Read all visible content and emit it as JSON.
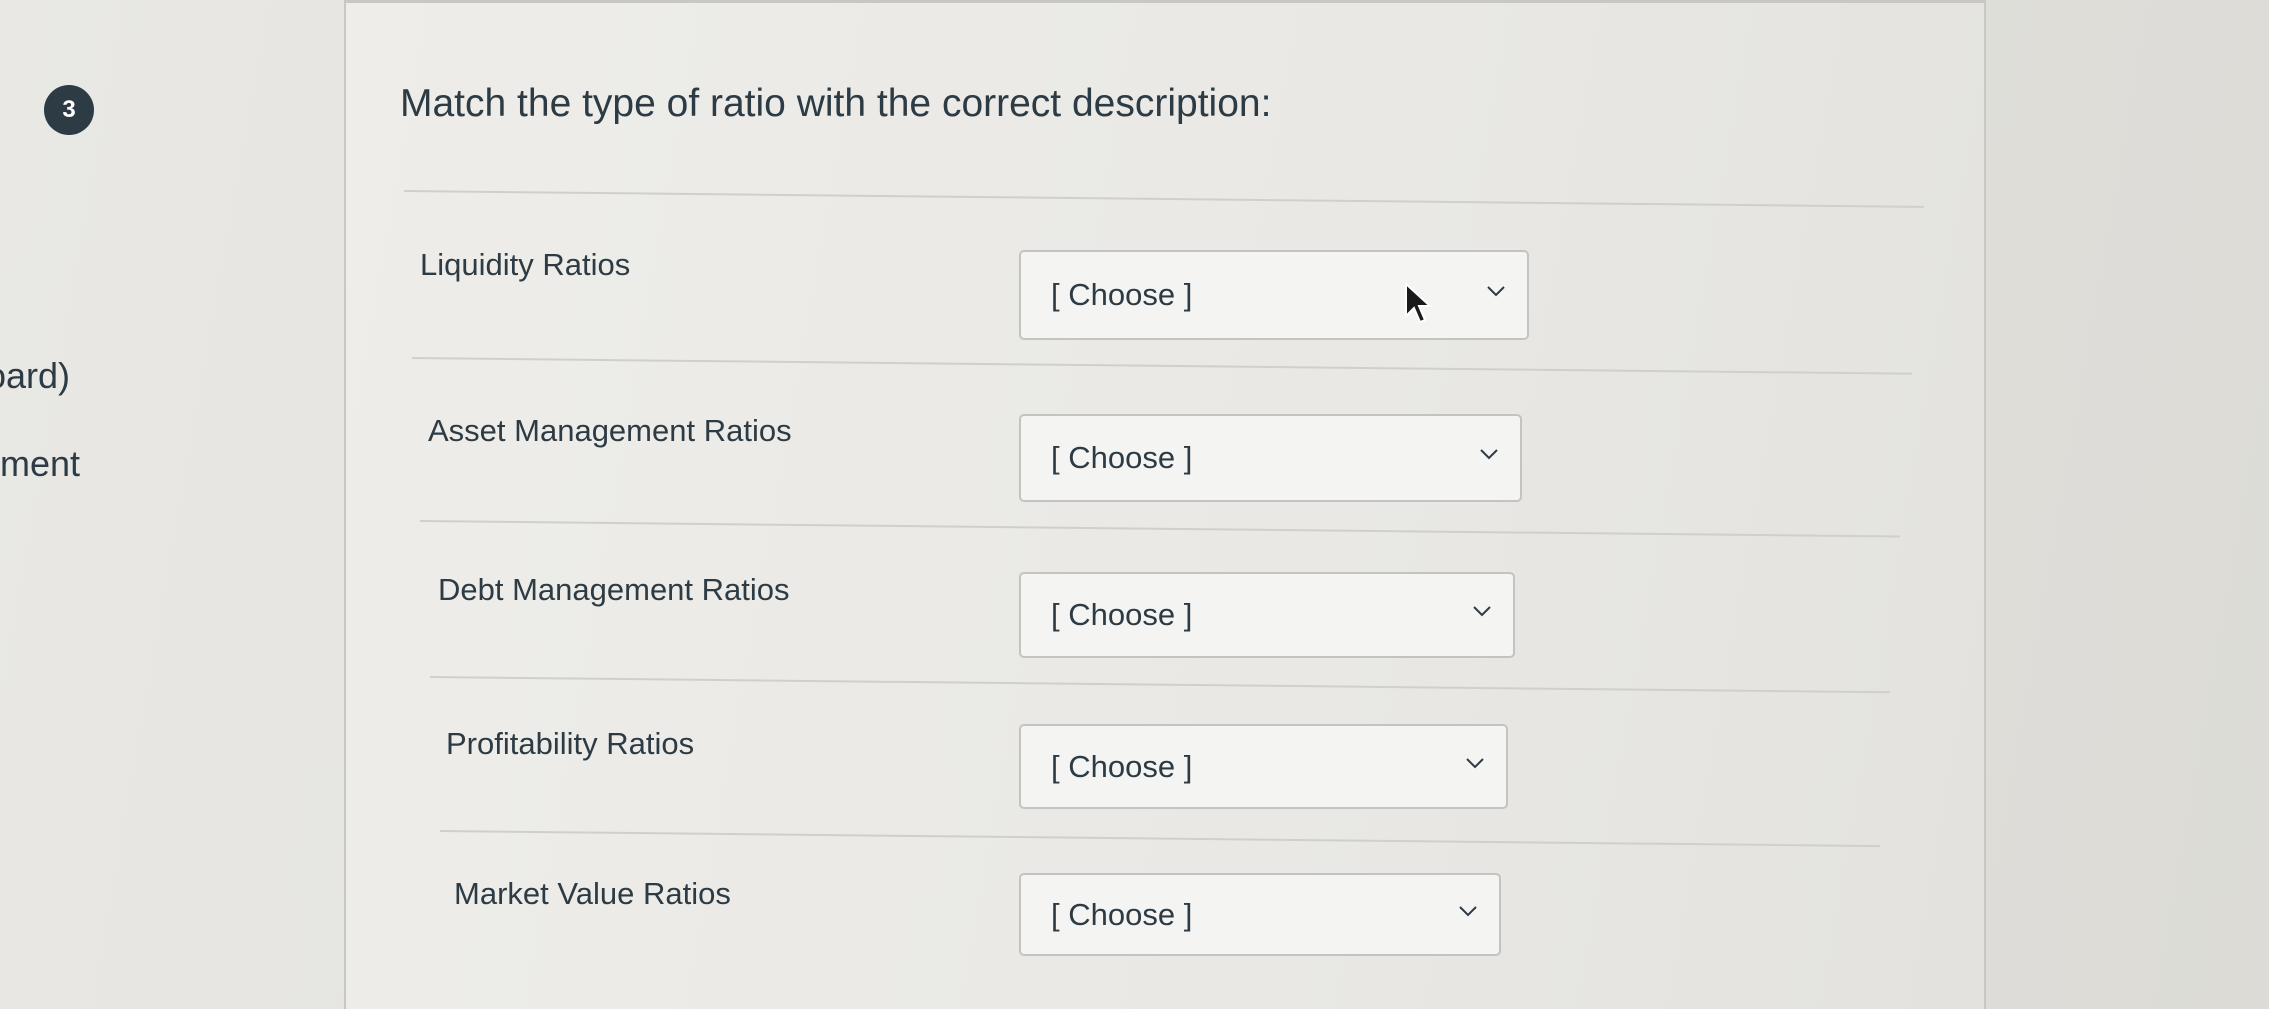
{
  "sidebar": {
    "partial_text_1": "oard)",
    "partial_text_2": "ment"
  },
  "question": {
    "number": "3",
    "prompt": "Match the type of ratio with the correct description:"
  },
  "rows": [
    {
      "label": "Liquidity Ratios",
      "selected": "[ Choose ]"
    },
    {
      "label": "Asset Management Ratios",
      "selected": "[ Choose ]"
    },
    {
      "label": "Debt Management Ratios",
      "selected": "[ Choose ]"
    },
    {
      "label": "Profitability Ratios",
      "selected": "[ Choose ]"
    },
    {
      "label": "Market Value Ratios",
      "selected": "[ Choose ]"
    }
  ],
  "icons": {
    "dropdown": "chevron-down-icon",
    "pointer": "mouse-cursor-icon"
  },
  "colors": {
    "text": "#2d3b45",
    "badge": "#2d3b45",
    "select_border": "#c3c4c2"
  }
}
